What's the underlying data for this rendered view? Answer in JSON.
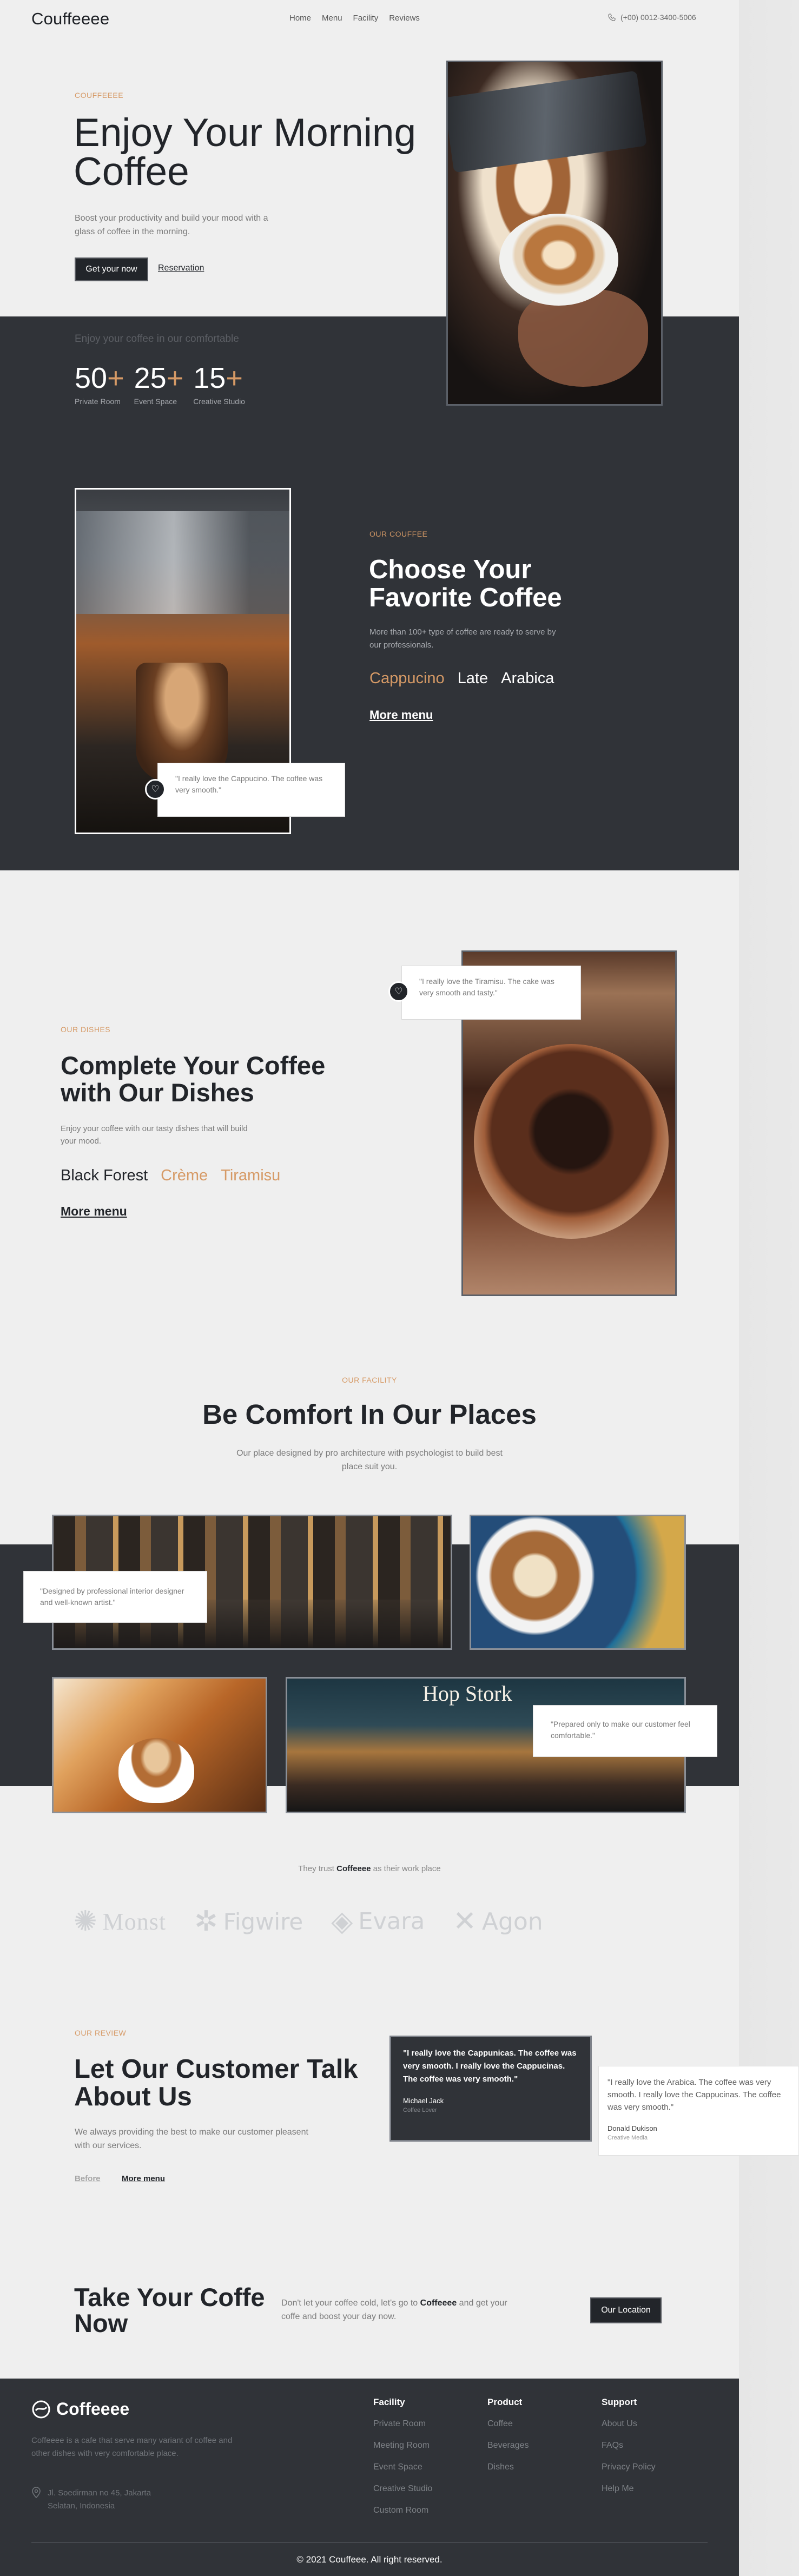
{
  "nav": {
    "logo": "Couffeeee",
    "links": [
      "Home",
      "Menu",
      "Facility",
      "Reviews"
    ],
    "phone": "(+00) 0012-3400-5006"
  },
  "hero": {
    "eyebrow": "COUFFEEEE",
    "title": "Enjoy Your Morning Coffee",
    "subtitle": "Boost your productivity and build your mood with a glass of coffee in the morning.",
    "primary_button": "Get your now",
    "secondary_link": "Reservation",
    "muted_line": "Enjoy your coffee in our comfortable",
    "stats": [
      {
        "value": "50",
        "suffix": "+",
        "label": "Private Room"
      },
      {
        "value": "25",
        "suffix": "+",
        "label": "Event Space"
      },
      {
        "value": "15",
        "suffix": "+",
        "label": "Creative Studio"
      }
    ]
  },
  "choose": {
    "eyebrow": "OUR COUFFEE",
    "title": "Choose Your Favorite Coffee",
    "subtitle": "More than 100+ type of coffee are ready to serve by our professionals.",
    "varieties": [
      "Cappucino",
      "Late",
      "Arabica"
    ],
    "more_link": "More menu",
    "quote": "\"I really love the Cappucino. The coffee was very smooth.\""
  },
  "dishes": {
    "eyebrow": "OUR DISHES",
    "title": "Complete Your Coffee with Our Dishes",
    "subtitle": "Enjoy your coffee with our tasty dishes that will build your mood.",
    "varieties": [
      "Black Forest",
      "Crème",
      "Tiramisu"
    ],
    "more_link": "More menu",
    "quote": "\"I really love the Tiramisu. The cake was very smooth and tasty.\""
  },
  "facility": {
    "eyebrow": "OUR FACILITY",
    "title": "Be Comfort In Our Places",
    "subtitle": "Our place designed by pro architecture with psychologist to build best place suit you.",
    "quote_1": "\"Designed by professional interior designer and well-known artist.\"",
    "quote_2": "\"Prepared only to make our customer feel comfortable.\"",
    "sign_text": "Hop Stork"
  },
  "trust": {
    "prefix": "They trust",
    "brand": "Coffeeee",
    "suffix": "as their work place",
    "logos": [
      "Monst",
      "Figwire",
      "Evara",
      "Agon"
    ]
  },
  "review": {
    "eyebrow": "OUR REVIEW",
    "title": "Let Our Customer Talk About Us",
    "subtitle": "We always providing the best to make our customer pleasent with our services.",
    "before_link": "Before",
    "more_link": "More menu",
    "cards": [
      {
        "text": "\"I really love the Cappunicas. The coffee was very smooth. I really love the Cappucinas. The coffee was very smooth.\"",
        "name": "Michael Jack",
        "role": "Coffee Lover"
      },
      {
        "text": "\"I really love the Arabica. The coffee was very smooth. I really love the Cappucinas. The coffee was very smooth.\"",
        "name": "Donald Dukison",
        "role": "Creative Media"
      }
    ]
  },
  "cta": {
    "title": "Take Your Coffe Now",
    "subtitle_prefix": "Don't let your coffee cold, let's go to",
    "subtitle_brand": "Coffeeee",
    "subtitle_suffix": "and get your coffe and boost your day now.",
    "button": "Our Location"
  },
  "footer": {
    "logo": "Coffeeee",
    "description": "Coffeeee is a cafe that serve many variant of coffee and other dishes with very comfortable place.",
    "address": "Jl. Soedirman no 45, Jakarta Selatan, Indonesia",
    "columns": [
      {
        "heading": "Facility",
        "items": [
          "Private Room",
          "Meeting Room",
          "Event Space",
          "Creative Studio",
          "Custom Room"
        ]
      },
      {
        "heading": "Product",
        "items": [
          "Coffee",
          "Beverages",
          "Dishes"
        ]
      },
      {
        "heading": "Support",
        "items": [
          "About Us",
          "FAQs",
          "Privacy Policy",
          "Help Me"
        ]
      }
    ],
    "copyright": "© 2021 Couffeee. All right reserved."
  },
  "colors": {
    "accent": "#d69a66",
    "dark": "#303338",
    "text": "#22252a",
    "bg": "#efefef"
  }
}
